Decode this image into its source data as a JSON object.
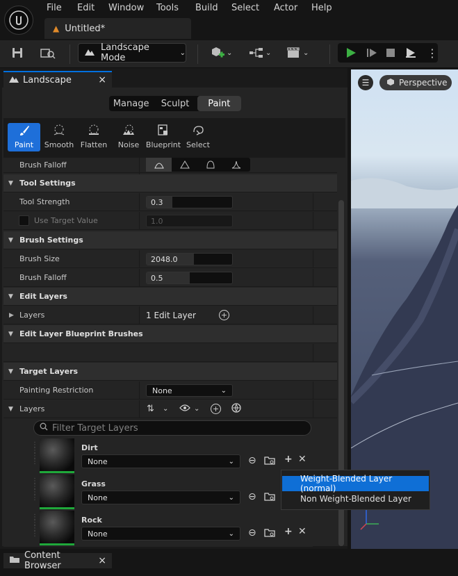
{
  "menu": [
    "File",
    "Edit",
    "Window",
    "Tools",
    "Build",
    "Select",
    "Actor",
    "Help"
  ],
  "document_tab": "Untitled*",
  "toolbar": {
    "mode": "Landscape Mode"
  },
  "panel": {
    "title": "Landscape",
    "close": "×",
    "modes": [
      "Manage",
      "Sculpt",
      "Paint"
    ],
    "active_mode": "Paint",
    "tools": [
      "Paint",
      "Smooth",
      "Flatten",
      "Noise",
      "Blueprint",
      "Select"
    ]
  },
  "rows": {
    "brush_falloff_top": "Brush Falloff",
    "tool_settings": "Tool Settings",
    "tool_strength": "Tool Strength",
    "tool_strength_value": "0.3",
    "tool_strength_fraction": 0.3,
    "use_target_value": "Use Target Value",
    "use_target_value_value": "1.0",
    "brush_settings": "Brush Settings",
    "brush_size": "Brush Size",
    "brush_size_value": "2048.0",
    "brush_size_fraction": 0.55,
    "brush_falloff": "Brush Falloff",
    "brush_falloff_value": "0.5",
    "brush_falloff_fraction": 0.5,
    "edit_layers": "Edit Layers",
    "layers_label": "Layers",
    "layers_value": "1 Edit Layer",
    "edit_layer_bp_brushes": "Edit Layer Blueprint Brushes",
    "target_layers": "Target Layers",
    "painting_restriction": "Painting Restriction",
    "painting_restriction_value": "None",
    "target_layers_label": "Layers",
    "filter_placeholder": "Filter Target Layers"
  },
  "target_layers": [
    {
      "name": "Dirt",
      "value": "None"
    },
    {
      "name": "Grass",
      "value": "None"
    },
    {
      "name": "Rock",
      "value": "None"
    }
  ],
  "popup": [
    "Weight-Blended Layer (normal)",
    "Non Weight-Blended Layer"
  ],
  "viewport": {
    "mode": "Perspective"
  },
  "bottom": {
    "content_browser": "Content Browser",
    "close": "×"
  },
  "colors": {
    "accent": "#1e6fd9",
    "play": "#3cb043",
    "layer_underline": "#1fa83a"
  }
}
